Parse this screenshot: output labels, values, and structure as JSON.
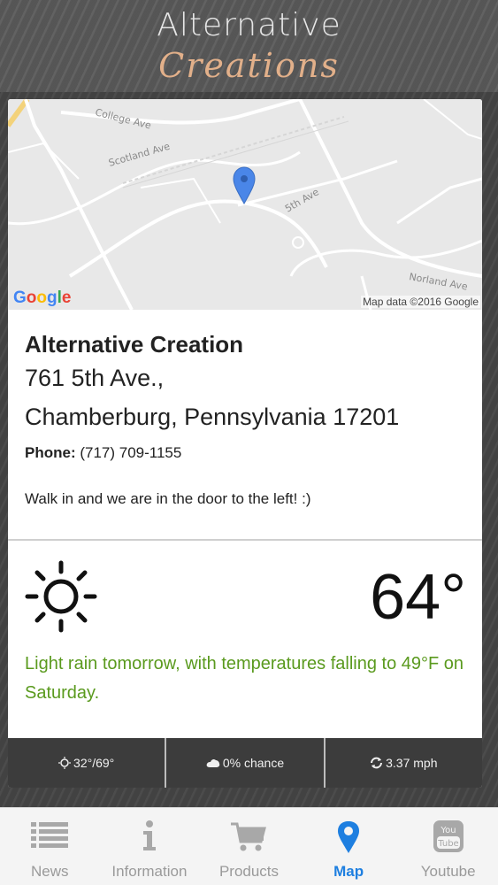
{
  "header": {
    "logo_line1": "Alternative",
    "logo_line2": "Creations"
  },
  "map": {
    "streets": [
      "College Ave",
      "Scotland Ave",
      "5th Ave",
      "Norland Ave"
    ],
    "google_logo": "Google",
    "attribution": "Map data ©2016 Google",
    "pin_color": "#4a86e8"
  },
  "business": {
    "name": "Alternative Creation",
    "address_line1": "761 5th Ave.,",
    "address_line2": "Chamberburg, Pennsylvania 17201",
    "phone_label": "Phone:",
    "phone_value": "(717) 709-1155",
    "note": "Walk in and we are in the door to the left! :)"
  },
  "weather": {
    "icon": "sun-icon",
    "temperature": "64°",
    "forecast": "Light rain tomorrow, with temperatures falling to 49°F on Saturday.",
    "forecast_color": "#5a9a1e",
    "hi_lo": "32°/69°",
    "precip": "0% chance",
    "wind": "3.37 mph"
  },
  "tabs": [
    {
      "label": "News",
      "icon": "list-icon",
      "active": false
    },
    {
      "label": "Information",
      "icon": "info-icon",
      "active": false
    },
    {
      "label": "Products",
      "icon": "cart-icon",
      "active": false
    },
    {
      "label": "Map",
      "icon": "map-pin-icon",
      "active": true
    },
    {
      "label": "Youtube",
      "icon": "youtube-icon",
      "active": false
    }
  ],
  "colors": {
    "active_tab": "#1e7fe0",
    "inactive_tab": "#9a9a9a"
  }
}
